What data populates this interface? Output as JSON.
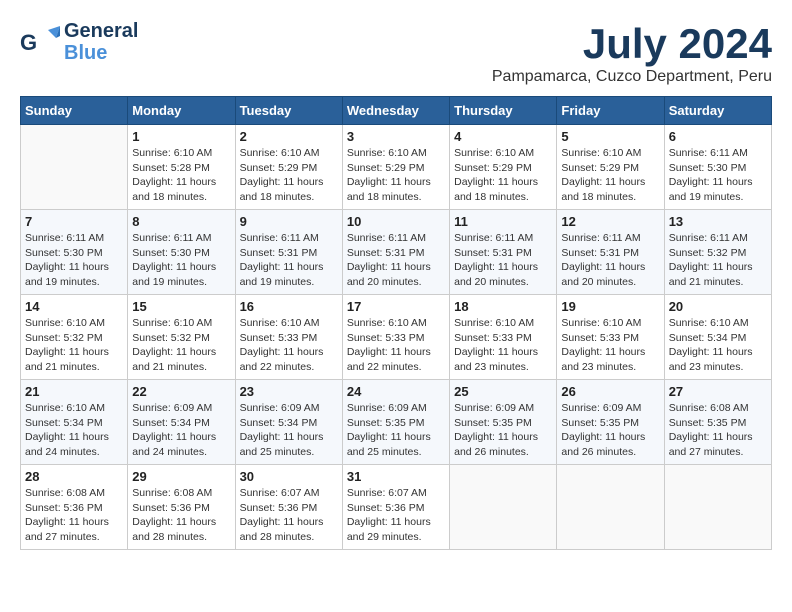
{
  "header": {
    "logo_line1": "General",
    "logo_line2": "Blue",
    "month": "July 2024",
    "location": "Pampamarca, Cuzco Department, Peru"
  },
  "days_of_week": [
    "Sunday",
    "Monday",
    "Tuesday",
    "Wednesday",
    "Thursday",
    "Friday",
    "Saturday"
  ],
  "weeks": [
    [
      {
        "day": "",
        "info": ""
      },
      {
        "day": "1",
        "info": "Sunrise: 6:10 AM\nSunset: 5:28 PM\nDaylight: 11 hours\nand 18 minutes."
      },
      {
        "day": "2",
        "info": "Sunrise: 6:10 AM\nSunset: 5:29 PM\nDaylight: 11 hours\nand 18 minutes."
      },
      {
        "day": "3",
        "info": "Sunrise: 6:10 AM\nSunset: 5:29 PM\nDaylight: 11 hours\nand 18 minutes."
      },
      {
        "day": "4",
        "info": "Sunrise: 6:10 AM\nSunset: 5:29 PM\nDaylight: 11 hours\nand 18 minutes."
      },
      {
        "day": "5",
        "info": "Sunrise: 6:10 AM\nSunset: 5:29 PM\nDaylight: 11 hours\nand 18 minutes."
      },
      {
        "day": "6",
        "info": "Sunrise: 6:11 AM\nSunset: 5:30 PM\nDaylight: 11 hours\nand 19 minutes."
      }
    ],
    [
      {
        "day": "7",
        "info": "Sunrise: 6:11 AM\nSunset: 5:30 PM\nDaylight: 11 hours\nand 19 minutes."
      },
      {
        "day": "8",
        "info": "Sunrise: 6:11 AM\nSunset: 5:30 PM\nDaylight: 11 hours\nand 19 minutes."
      },
      {
        "day": "9",
        "info": "Sunrise: 6:11 AM\nSunset: 5:31 PM\nDaylight: 11 hours\nand 19 minutes."
      },
      {
        "day": "10",
        "info": "Sunrise: 6:11 AM\nSunset: 5:31 PM\nDaylight: 11 hours\nand 20 minutes."
      },
      {
        "day": "11",
        "info": "Sunrise: 6:11 AM\nSunset: 5:31 PM\nDaylight: 11 hours\nand 20 minutes."
      },
      {
        "day": "12",
        "info": "Sunrise: 6:11 AM\nSunset: 5:31 PM\nDaylight: 11 hours\nand 20 minutes."
      },
      {
        "day": "13",
        "info": "Sunrise: 6:11 AM\nSunset: 5:32 PM\nDaylight: 11 hours\nand 21 minutes."
      }
    ],
    [
      {
        "day": "14",
        "info": "Sunrise: 6:10 AM\nSunset: 5:32 PM\nDaylight: 11 hours\nand 21 minutes."
      },
      {
        "day": "15",
        "info": "Sunrise: 6:10 AM\nSunset: 5:32 PM\nDaylight: 11 hours\nand 21 minutes."
      },
      {
        "day": "16",
        "info": "Sunrise: 6:10 AM\nSunset: 5:33 PM\nDaylight: 11 hours\nand 22 minutes."
      },
      {
        "day": "17",
        "info": "Sunrise: 6:10 AM\nSunset: 5:33 PM\nDaylight: 11 hours\nand 22 minutes."
      },
      {
        "day": "18",
        "info": "Sunrise: 6:10 AM\nSunset: 5:33 PM\nDaylight: 11 hours\nand 23 minutes."
      },
      {
        "day": "19",
        "info": "Sunrise: 6:10 AM\nSunset: 5:33 PM\nDaylight: 11 hours\nand 23 minutes."
      },
      {
        "day": "20",
        "info": "Sunrise: 6:10 AM\nSunset: 5:34 PM\nDaylight: 11 hours\nand 23 minutes."
      }
    ],
    [
      {
        "day": "21",
        "info": "Sunrise: 6:10 AM\nSunset: 5:34 PM\nDaylight: 11 hours\nand 24 minutes."
      },
      {
        "day": "22",
        "info": "Sunrise: 6:09 AM\nSunset: 5:34 PM\nDaylight: 11 hours\nand 24 minutes."
      },
      {
        "day": "23",
        "info": "Sunrise: 6:09 AM\nSunset: 5:34 PM\nDaylight: 11 hours\nand 25 minutes."
      },
      {
        "day": "24",
        "info": "Sunrise: 6:09 AM\nSunset: 5:35 PM\nDaylight: 11 hours\nand 25 minutes."
      },
      {
        "day": "25",
        "info": "Sunrise: 6:09 AM\nSunset: 5:35 PM\nDaylight: 11 hours\nand 26 minutes."
      },
      {
        "day": "26",
        "info": "Sunrise: 6:09 AM\nSunset: 5:35 PM\nDaylight: 11 hours\nand 26 minutes."
      },
      {
        "day": "27",
        "info": "Sunrise: 6:08 AM\nSunset: 5:35 PM\nDaylight: 11 hours\nand 27 minutes."
      }
    ],
    [
      {
        "day": "28",
        "info": "Sunrise: 6:08 AM\nSunset: 5:36 PM\nDaylight: 11 hours\nand 27 minutes."
      },
      {
        "day": "29",
        "info": "Sunrise: 6:08 AM\nSunset: 5:36 PM\nDaylight: 11 hours\nand 28 minutes."
      },
      {
        "day": "30",
        "info": "Sunrise: 6:07 AM\nSunset: 5:36 PM\nDaylight: 11 hours\nand 28 minutes."
      },
      {
        "day": "31",
        "info": "Sunrise: 6:07 AM\nSunset: 5:36 PM\nDaylight: 11 hours\nand 29 minutes."
      },
      {
        "day": "",
        "info": ""
      },
      {
        "day": "",
        "info": ""
      },
      {
        "day": "",
        "info": ""
      }
    ]
  ]
}
